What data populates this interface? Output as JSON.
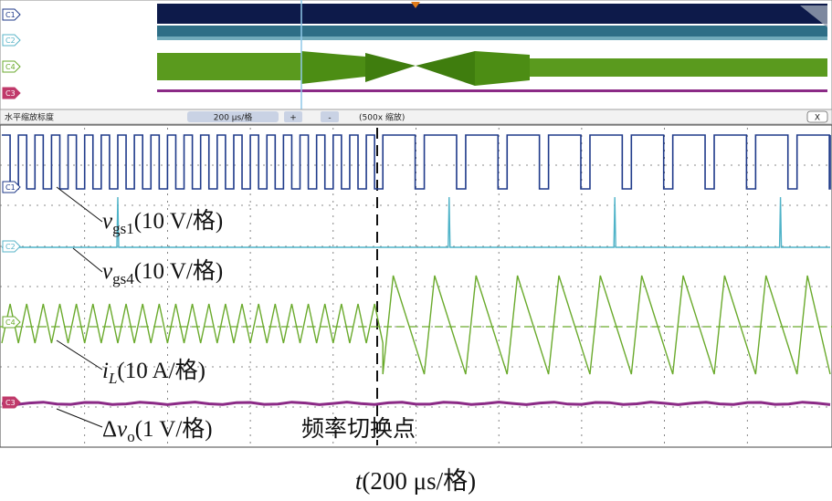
{
  "overview": {
    "channels": [
      {
        "id": "C1",
        "color": "#1f3a8a"
      },
      {
        "id": "C2",
        "color": "#5ab4c8"
      },
      {
        "id": "C4",
        "color": "#6aa82c"
      },
      {
        "id": "C3",
        "color": "#b0307a"
      }
    ]
  },
  "zoom_bar": {
    "label": "水平缩放标度",
    "scale": "200 μs/格",
    "plus": "+",
    "minus": "-",
    "zoom_factor": "(500x 缩放)",
    "close": "X"
  },
  "main": {
    "channel_tags": [
      "C1",
      "C2",
      "C4",
      "C3"
    ],
    "labels": {
      "vgs1": {
        "sym": "v",
        "sub": "gs1",
        "rest": "(10 V/格)"
      },
      "vgs4": {
        "sym": "v",
        "sub": "gs4",
        "rest": "(10 V/格)"
      },
      "iL": {
        "sym": "i",
        "sub": "L",
        "rest": "(10 A/格)"
      },
      "dvo": {
        "delta": "Δ",
        "sym": "v",
        "sub": "o",
        "rest": "(1 V/格)"
      },
      "switch_point": "频率切换点"
    },
    "xlabel": {
      "sym": "t",
      "rest": "(200 μs/格)"
    }
  },
  "colors": {
    "c1": "#1f3a8a",
    "c2": "#4fb3c8",
    "c4": "#6aaa2c",
    "c3": "#8b2a86",
    "tag_c3": "#c0396a",
    "grid": "#555555",
    "overview_bg": "#0d1a4a"
  },
  "chart_data": {
    "type": "line",
    "x_unit": "μs",
    "x_per_div": 200,
    "divisions": 10,
    "switch_time_us": 900,
    "series": [
      {
        "channel": "C1",
        "kind": "gate pulses",
        "period_before_us": 40,
        "period_after_us": 100
      },
      {
        "channel": "C2",
        "kind": "gate spikes",
        "spike_times_us": [
          280,
          1080,
          1480,
          1880
        ]
      },
      {
        "channel": "C4",
        "kind": "inductor current ripple",
        "period_before_us": 40,
        "period_after_us": 100
      },
      {
        "channel": "C3",
        "kind": "output voltage ripple"
      }
    ]
  }
}
